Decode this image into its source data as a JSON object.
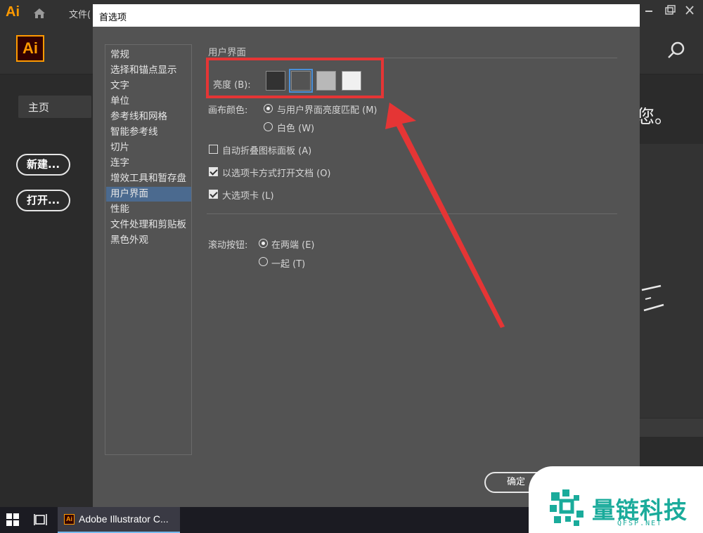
{
  "app": {
    "logo_small": "Ai",
    "logo": "Ai",
    "menu_file": "文件(",
    "sidebar_home": "主页",
    "new_button": "新建...",
    "open_button": "打开...",
    "right_text": "您。"
  },
  "dialog": {
    "title": "首选项",
    "nav": [
      "常规",
      "选择和锚点显示",
      "文字",
      "单位",
      "参考线和网格",
      "智能参考线",
      "切片",
      "连字",
      "增效工具和暂存盘",
      "用户界面",
      "性能",
      "文件处理和剪贴板",
      "黑色外观"
    ],
    "selected_nav": "用户界面",
    "section_title": "用户界面",
    "brightness_label": "亮度 (B):",
    "brightness_swatches": [
      "#323232",
      "#535353",
      "#b8b8b8",
      "#f0f0f0"
    ],
    "canvas_color_label": "画布颜色:",
    "canvas_options": [
      "与用户界面亮度匹配 (M)",
      "白色 (W)"
    ],
    "checkboxes": [
      {
        "label": "自动折叠图标面板 (A)",
        "checked": false
      },
      {
        "label": "以选项卡方式打开文档 (O)",
        "checked": true
      },
      {
        "label": "大选项卡 (L)",
        "checked": true
      }
    ],
    "scroll_label": "滚动按钮:",
    "scroll_options": [
      "在两端 (E)",
      "一起 (T)"
    ],
    "ok_button": "确定"
  },
  "taskbar": {
    "app_icon": "Ai",
    "app_label": "Adobe Illustrator C..."
  },
  "watermark": {
    "text": "量链科技",
    "sub": "QFSP.NET"
  },
  "colors": {
    "accent_orange": "#ff9a00",
    "annotation_red": "#e53535",
    "selection_blue": "#4b6a8f",
    "watermark_teal": "#1aab9b"
  }
}
